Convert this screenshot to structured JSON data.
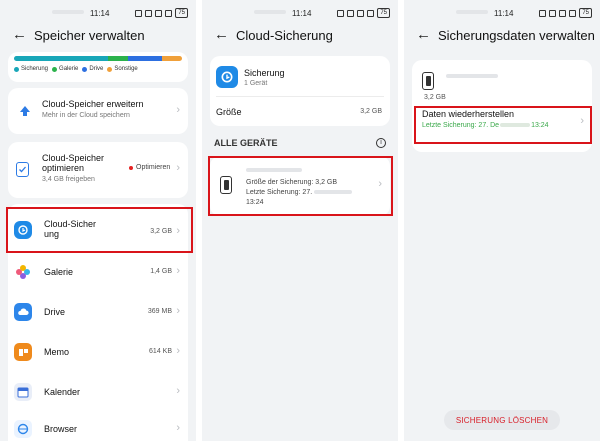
{
  "status": {
    "time": "11:14",
    "battery": "75"
  },
  "screen1": {
    "title": "Speicher verwalten",
    "bar_colors": [
      "#18a6b8",
      "#2bb24c",
      "#2d6fe0",
      "#f0a03a"
    ],
    "bar_fractions": [
      0.56,
      0.12,
      0.2,
      0.12
    ],
    "legend": [
      "Sicherung",
      "Galerie",
      "Drive",
      "Sonstige"
    ],
    "expand": {
      "title": "Cloud-Speicher erweitern",
      "sub": "Mehr in der Cloud speichern"
    },
    "optimize": {
      "title_l1": "Cloud-Speicher",
      "title_l2": "optimieren",
      "sub": "3,4 GB freigeben",
      "badge": "Optimieren"
    },
    "items": [
      {
        "label_l1": "Cloud-Sicher",
        "label_l2": "ung",
        "value": "3,2 GB"
      },
      {
        "label": "Galerie",
        "value": "1,4 GB"
      },
      {
        "label": "Drive",
        "value": "369 MB"
      },
      {
        "label": "Memo",
        "value": "614 KB"
      },
      {
        "label": "Kalender",
        "value": ""
      },
      {
        "label": "Browser",
        "value": ""
      }
    ]
  },
  "screen2": {
    "title": "Cloud-Sicherung",
    "app_title": "Sicherung",
    "app_sub": "1 Gerät",
    "size_label": "Größe",
    "size_value": "3,2 GB",
    "section": "ALLE GERÄTE",
    "device_size": "Größe der Sicherung: 3,2 GB",
    "device_last_l1": "Letzte Sicherung: 27.",
    "device_last_l2": "13:24"
  },
  "screen3": {
    "title": "Sicherungsdaten verwalten",
    "size": "3,2 GB",
    "restore_title": "Daten wiederherstellen",
    "restore_sub_a": "Letzte Sicherung: 27. De",
    "restore_sub_b": "13:24",
    "delete_btn": "SICHERUNG LÖSCHEN"
  }
}
